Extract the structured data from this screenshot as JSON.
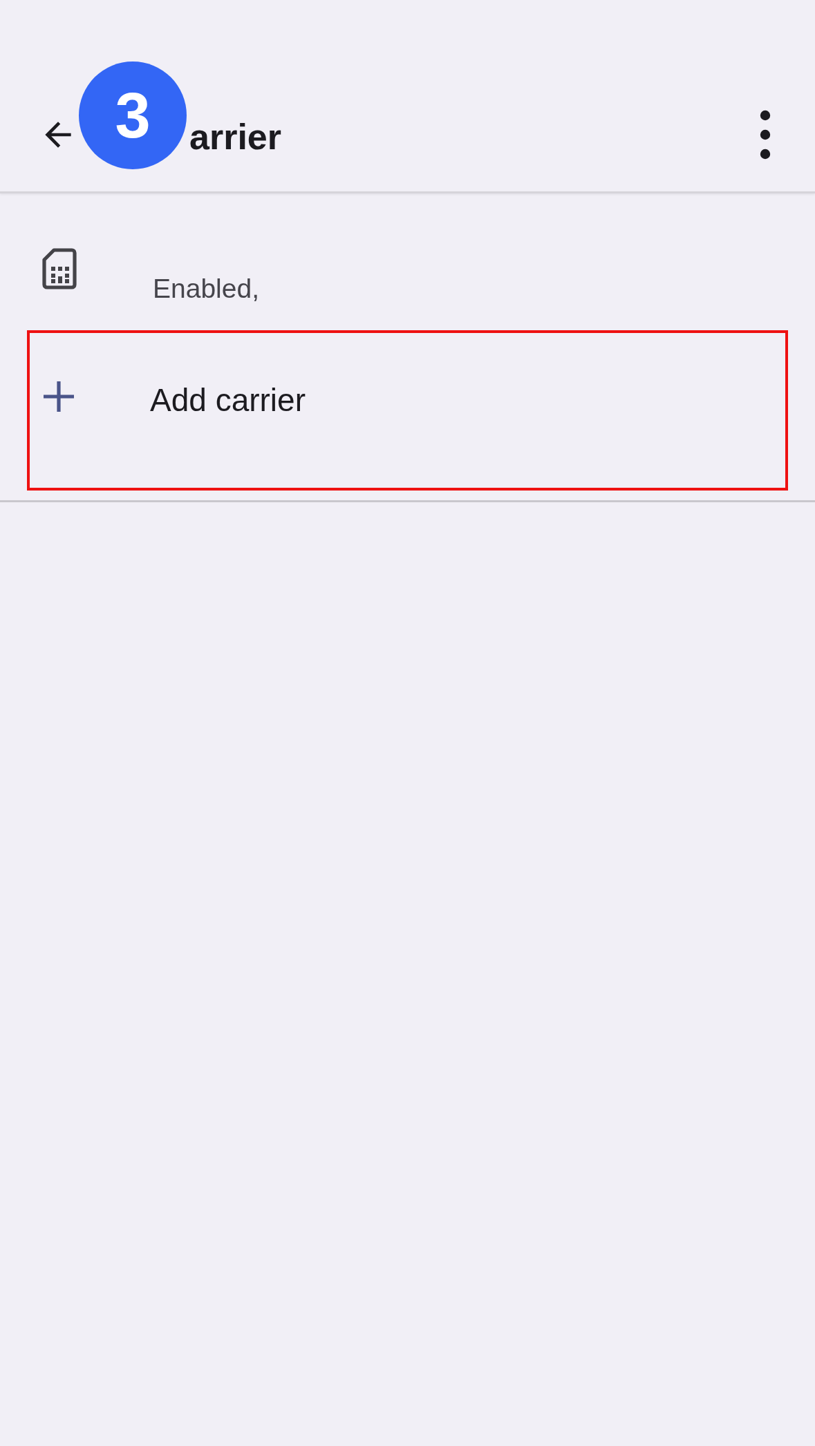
{
  "header": {
    "title": "arrier"
  },
  "annotation": {
    "badge": "3"
  },
  "items": [
    {
      "kind": "sim",
      "summary": "Enabled,",
      "highlighted": false
    },
    {
      "kind": "add",
      "title": "Add carrier",
      "highlighted": true
    }
  ]
}
